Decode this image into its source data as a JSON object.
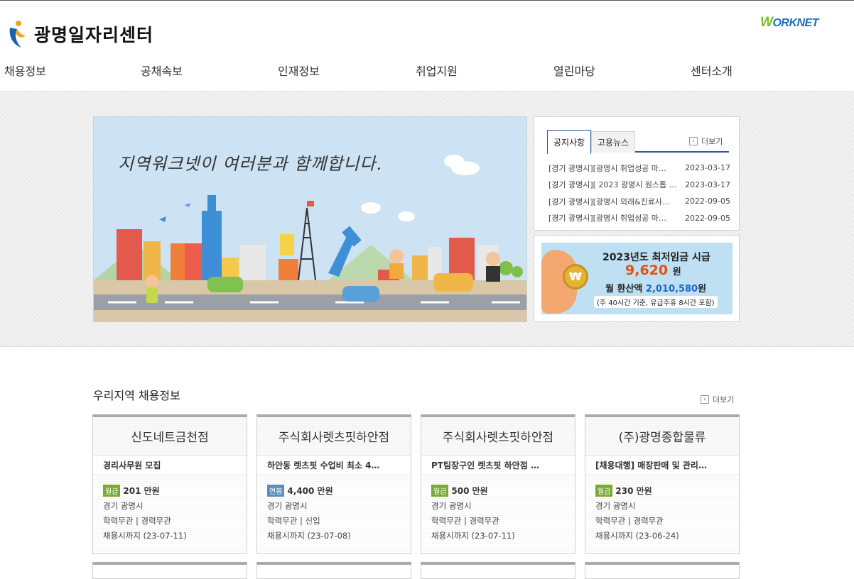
{
  "header": {
    "logo_text": "광명일자리센터",
    "partner_logo_prefix": "W",
    "partner_logo_rest": "ORKNET"
  },
  "nav": [
    "채용정보",
    "공채속보",
    "인재정보",
    "취업지원",
    "열린마당",
    "센터소개"
  ],
  "banner": {
    "text": "지역워크넷이 여러분과 함께합니다."
  },
  "notice": {
    "tabs": [
      "공지사항",
      "고용뉴스"
    ],
    "more_label": "더보기",
    "items": [
      {
        "title": "[경기 광명시][광명시 취업성공 마…",
        "date": "2023-03-17"
      },
      {
        "title": "[경기 광명시][ 2023 광명시 원스톱 …",
        "date": "2023-03-17"
      },
      {
        "title": "[경기 광명시][광명시 외래&진료사…",
        "date": "2022-09-05"
      },
      {
        "title": "[경기 광명시][광명시 취업성공 마…",
        "date": "2022-09-05"
      }
    ]
  },
  "wage": {
    "title": "2023년도 최저임금 시급",
    "amount": "9,620",
    "amount_unit": "원",
    "month_prefix": "월 환산액",
    "month_value": "2,010,580",
    "month_unit": "원",
    "note": "(주 40시간 기준, 유급주휴 8시간 포함)",
    "coin_symbol": "₩"
  },
  "jobs": {
    "title": "우리지역 채용정보",
    "more_label": "더보기",
    "badge_colors": {
      "월급": "#7aab2e",
      "연봉": "#5b8fbd"
    },
    "cards": [
      {
        "company": "신도네트금천점",
        "position": "경리사무원 모집",
        "pay_type": "월급",
        "pay": "201 만원",
        "location": "경기 광명시",
        "requirements": "학력무관 | 경력무관",
        "deadline": "채용시까지 (23-07-11)"
      },
      {
        "company": "주식회사렛츠핏하안점",
        "position": "하안동 렛츠핏 수업비 최소 4…",
        "pay_type": "연봉",
        "pay": "4,400 만원",
        "location": "경기 광명시",
        "requirements": "학력무관 | 신입",
        "deadline": "채용시까지 (23-07-08)"
      },
      {
        "company": "주식회사렛츠핏하안점",
        "position": "PT팀장구인 렛츠핏 하안점 …",
        "pay_type": "월급",
        "pay": "500 만원",
        "location": "경기 광명시",
        "requirements": "학력무관 | 경력무관",
        "deadline": "채용시까지 (23-07-11)"
      },
      {
        "company": "(주)광명종합물류",
        "position": "[채용대행] 매장판매 및 관리…",
        "pay_type": "월급",
        "pay": "230 만원",
        "location": "경기 광명시",
        "requirements": "학력무관 | 경력무관",
        "deadline": "채용시까지 (23-06-24)"
      }
    ]
  }
}
